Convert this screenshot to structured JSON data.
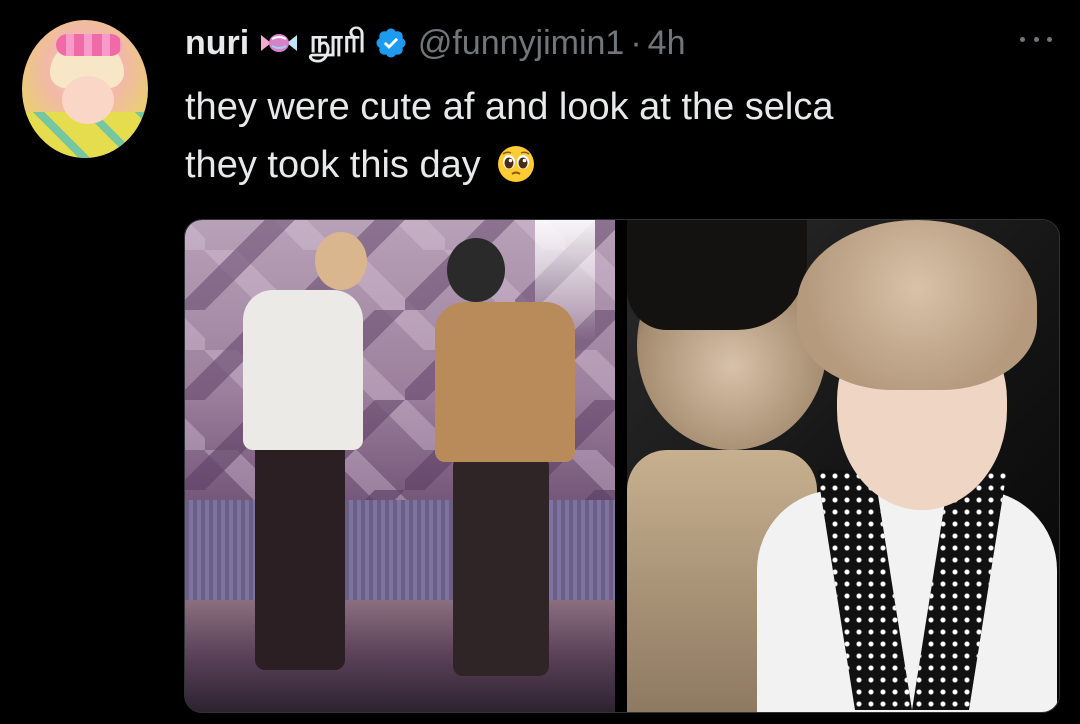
{
  "tweet": {
    "display_name": "nuri",
    "secondary_name": "நூரி",
    "handle": "@funnyjimin1",
    "separator": "·",
    "time": "4h",
    "text_line1": "they were cute af and look at the selca",
    "text_line2": "they took this day",
    "emoji_icon": "pleading-face-icon",
    "name_emoji_icon": "candy-icon",
    "verified_icon": "verified-badge-icon"
  },
  "colors": {
    "background": "#000000",
    "primary_text": "#e7e9ea",
    "secondary_text": "#71767b",
    "verified": "#1d9bf0",
    "media_border": "#2f3336"
  }
}
